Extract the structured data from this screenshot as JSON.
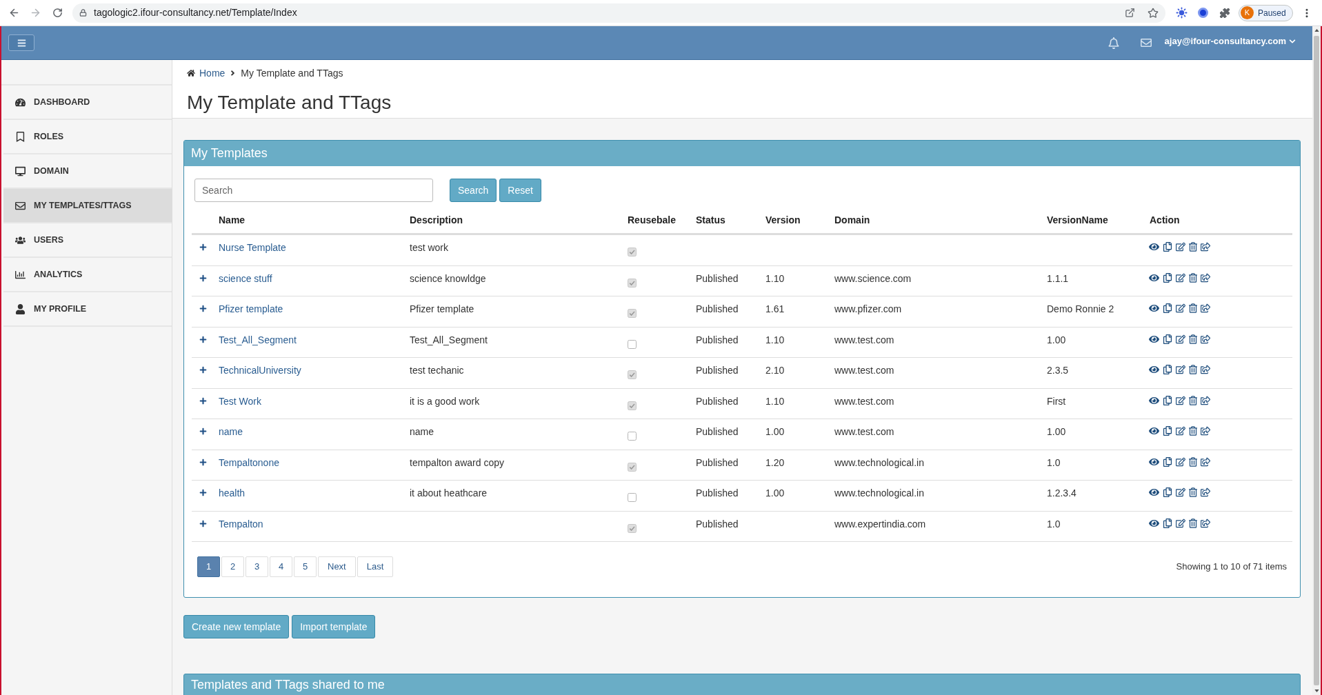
{
  "browser": {
    "url": "tagologic2.ifour-consultancy.net/Template/Index",
    "profile": {
      "initial": "K",
      "status": "Paused"
    }
  },
  "header": {
    "user_email": "ajay@ifour-consultancy.com"
  },
  "sidebar": {
    "items": [
      {
        "label": "DASHBOARD",
        "selected": false
      },
      {
        "label": "ROLES",
        "selected": false
      },
      {
        "label": "DOMAIN",
        "selected": false
      },
      {
        "label": "MY TEMPLATES/TTAGS",
        "selected": true
      },
      {
        "label": "USERS",
        "selected": false
      },
      {
        "label": "ANALYTICS",
        "selected": false
      },
      {
        "label": "MY PROFILE",
        "selected": false
      }
    ]
  },
  "breadcrumb": [
    "Home",
    "My Template and TTags"
  ],
  "page_title": "My Template and TTags",
  "templates_panel": {
    "title": "My Templates",
    "search": {
      "placeholder": "Search"
    },
    "buttons": [
      "Search",
      "Reset"
    ],
    "table": {
      "columns": [
        "Name",
        "Description",
        "Reusebale",
        "Status",
        "Version",
        "Domain",
        "VersionName",
        "Action"
      ],
      "rows": [
        {
          "name": "Nurse Template",
          "description": "test work",
          "reusable": true
        },
        {
          "name": "science stuff",
          "description": "science knowldge",
          "reusable": true,
          "status": "Published",
          "version": "1.10",
          "domain": "www.science.com",
          "version_name": "1.1.1"
        },
        {
          "name": "Pfizer template",
          "description": "Pfizer template",
          "reusable": true,
          "status": "Published",
          "version": "1.61",
          "domain": "www.pfizer.com",
          "version_name": "Demo Ronnie 2"
        },
        {
          "name": "Test_All_Segment",
          "description": "Test_All_Segment",
          "reusable": false,
          "status": "Published",
          "version": "1.10",
          "domain": "www.test.com",
          "version_name": "1.00"
        },
        {
          "name": "TechnicalUniversity",
          "description": "test techanic",
          "reusable": true,
          "status": "Published",
          "version": "2.10",
          "domain": "www.test.com",
          "version_name": "2.3.5"
        },
        {
          "name": "Test Work",
          "description": "it is a good work",
          "reusable": true,
          "status": "Published",
          "version": "1.10",
          "domain": "www.test.com",
          "version_name": "First"
        },
        {
          "name": "name",
          "description": "name",
          "reusable": false,
          "status": "Published",
          "version": "1.00",
          "domain": "www.test.com",
          "version_name": "1.00"
        },
        {
          "name": "Tempaltonone",
          "description": "tempalton award copy",
          "reusable": true,
          "status": "Published",
          "version": "1.20",
          "domain": "www.technological.in",
          "version_name": "1.0"
        },
        {
          "name": "health",
          "description": "it about heathcare",
          "reusable": false,
          "status": "Published",
          "version": "1.00",
          "domain": "www.technological.in",
          "version_name": "1.2.3.4"
        },
        {
          "name": "Tempalton",
          "reusable": true,
          "status": "Published",
          "domain": "www.expertindia.com",
          "version_name": "1.0"
        }
      ]
    },
    "pagination": {
      "pages": [
        {
          "label": "1",
          "selected": true
        },
        {
          "label": "2",
          "selected": false
        },
        {
          "label": "3",
          "selected": false
        },
        {
          "label": "4",
          "selected": false
        },
        {
          "label": "5",
          "selected": false
        }
      ],
      "nav": [
        "Next",
        "Last"
      ]
    },
    "summary": "Showing 1 to 10 of 71 items"
  },
  "actions": [
    "Create new template",
    "Import template"
  ],
  "shared_panel": {
    "title": "Templates and TTags shared to me"
  }
}
